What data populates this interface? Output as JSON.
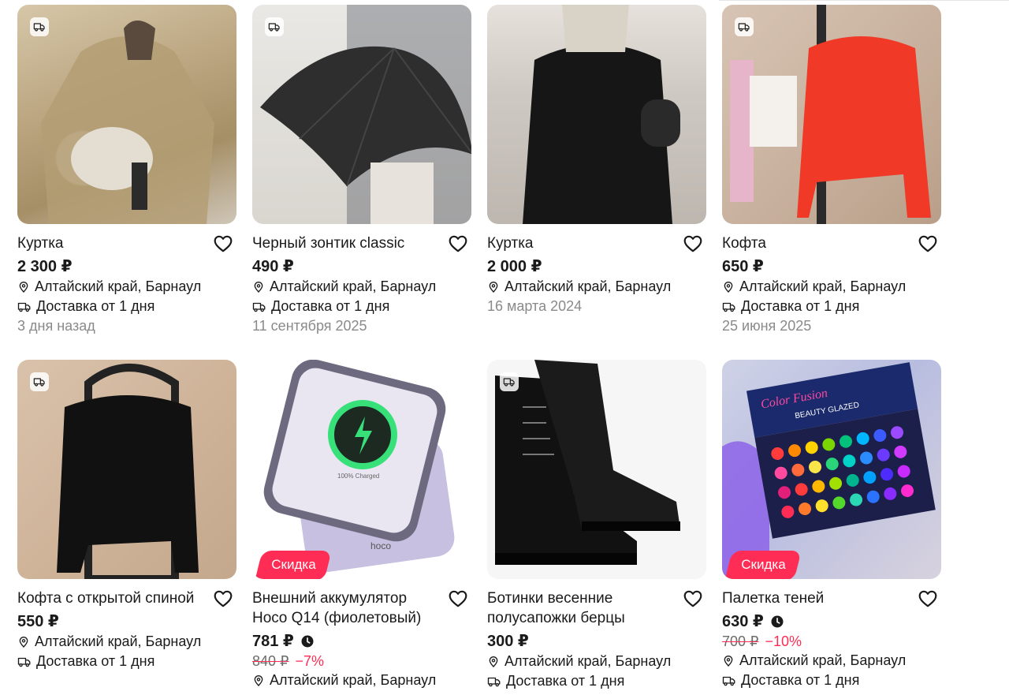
{
  "products": [
    {
      "title": "Куртка",
      "price": "2 300 ₽",
      "location": "Алтайский край, Барнаул",
      "delivery": "Доставка от 1 дня",
      "date": "3 дня назад"
    },
    {
      "title": "Черный зонтик classic",
      "price": "490 ₽",
      "location": "Алтайский край, Барнаул",
      "delivery": "Доставка от 1 дня",
      "date": "11 сентября 2025"
    },
    {
      "title": "Куртка",
      "price": "2 000 ₽",
      "location": "Алтайский край, Барнаул",
      "date": "16 марта 2024"
    },
    {
      "title": "Кофта",
      "price": "650 ₽",
      "location": "Алтайский край, Барнаул",
      "delivery": "Доставка от 1 дня",
      "date": "25 июня 2025"
    },
    {
      "title": "Кофта с открытой спиной",
      "price": "550 ₽",
      "location": "Алтайский край, Барнаул",
      "delivery": "Доставка от 1 дня"
    },
    {
      "title": "Внешний аккумулятор Hoco Q14 (фиолетовый)",
      "price": "781 ₽",
      "old_price": "840 ₽",
      "discount": "−7%",
      "badge": "Скидка",
      "location": "Алтайский край, Барнаул"
    },
    {
      "title": "Ботинки весенние полусапожки берцы",
      "price": "300 ₽",
      "location": "Алтайский край, Барнаул",
      "delivery": "Доставка от 1 дня"
    },
    {
      "title": "Палетка теней",
      "price": "630 ₽",
      "old_price": "700 ₽",
      "discount": "−10%",
      "badge": "Скидка",
      "location": "Алтайский край, Барнаул",
      "delivery": "Доставка от 1 дня"
    }
  ],
  "image_texts": {
    "palette_brand": "Color Fusion",
    "palette_sub": "BEAUTY GLAZED",
    "powerbank_brand": "hoco",
    "powerbank_status": "100% Charged"
  },
  "colors": {
    "accent": "#ff2d55",
    "text": "#1a1a1a",
    "muted": "#8a8a8a"
  },
  "icons": [
    "delivery-truck-icon",
    "heart-icon",
    "location-pin-icon",
    "clock-icon"
  ]
}
